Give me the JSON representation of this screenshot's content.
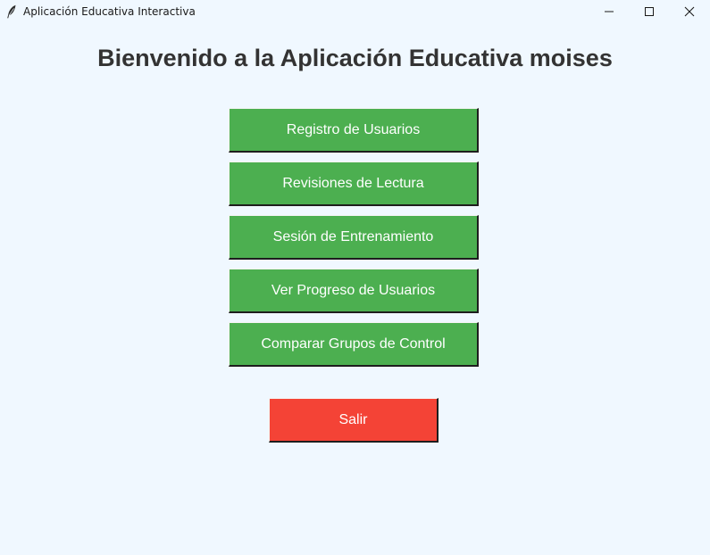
{
  "window": {
    "title": "Aplicación Educativa Interactiva",
    "icon": "feather-icon",
    "controls": {
      "minimize_icon": "minimize-icon",
      "maximize_icon": "maximize-icon",
      "close_icon": "close-icon"
    }
  },
  "main": {
    "heading": "Bienvenido a la Aplicación Educativa moises",
    "menu_buttons": [
      {
        "label": "Registro de Usuarios"
      },
      {
        "label": "Revisiones de Lectura"
      },
      {
        "label": "Sesión de Entrenamiento"
      },
      {
        "label": "Ver Progreso de Usuarios"
      },
      {
        "label": "Comparar Grupos de Control"
      }
    ],
    "exit_button": {
      "label": "Salir"
    }
  },
  "colors": {
    "background": "#f0f8ff",
    "menu_button": "#4caf50",
    "exit_button": "#f44336",
    "heading_text": "#333333",
    "button_text": "#ffffff"
  }
}
